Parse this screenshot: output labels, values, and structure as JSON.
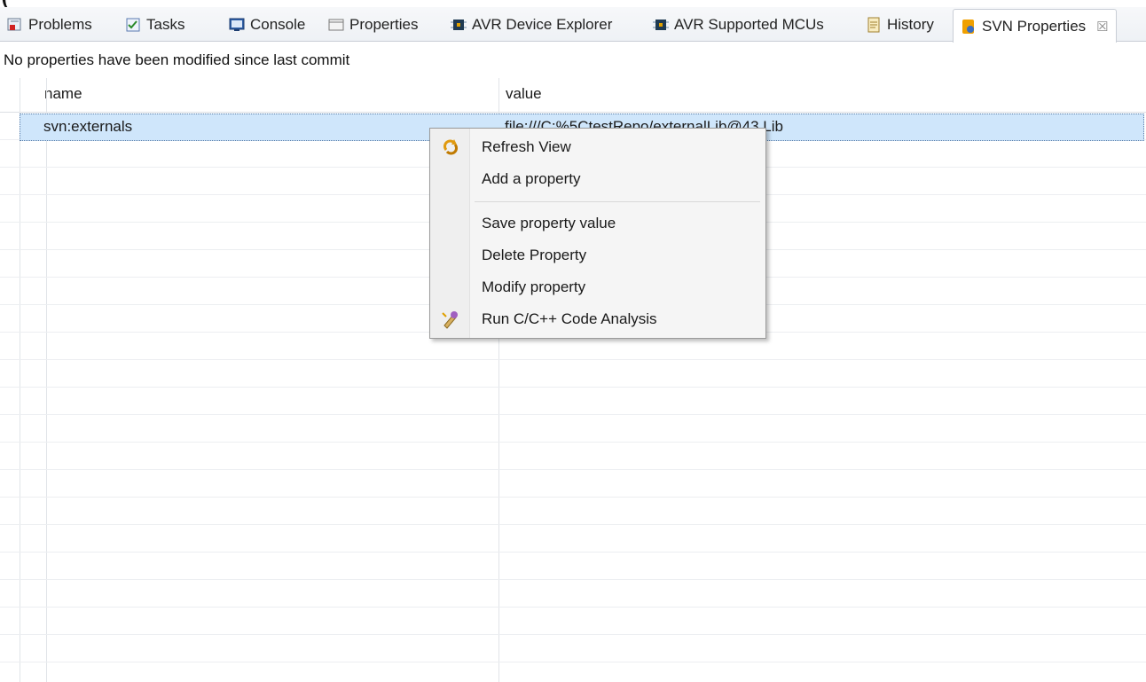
{
  "caption": "(",
  "tabs": [
    {
      "label": "Problems",
      "icon": "problems-icon"
    },
    {
      "label": "Tasks",
      "icon": "tasks-icon"
    },
    {
      "label": "Console",
      "icon": "console-icon"
    },
    {
      "label": "Properties",
      "icon": "properties-icon"
    },
    {
      "label": "AVR Device Explorer",
      "icon": "chip-icon"
    },
    {
      "label": "AVR Supported MCUs",
      "icon": "chip-icon"
    },
    {
      "label": "History",
      "icon": "history-icon"
    },
    {
      "label": "SVN Properties",
      "icon": "svn-icon",
      "active": true,
      "close": "☒"
    }
  ],
  "status": "No properties have been modified since last commit",
  "table": {
    "columns": [
      "name",
      "value"
    ],
    "rows": [
      {
        "name": "svn:externals",
        "value": "file:///C:%5CtestRepo/externalLib@43 Lib"
      }
    ]
  },
  "context_menu": {
    "items": [
      {
        "label": "Refresh View",
        "icon": "refresh-icon"
      },
      {
        "label": "Add a property"
      },
      {
        "label": "Save property value"
      },
      {
        "label": "Delete Property"
      },
      {
        "label": "Modify property"
      },
      {
        "label": "Run C/C++ Code Analysis",
        "icon": "code-analysis-icon"
      }
    ]
  },
  "colors": {
    "selection": "#cfe6fb",
    "accent": "#f0a000"
  }
}
